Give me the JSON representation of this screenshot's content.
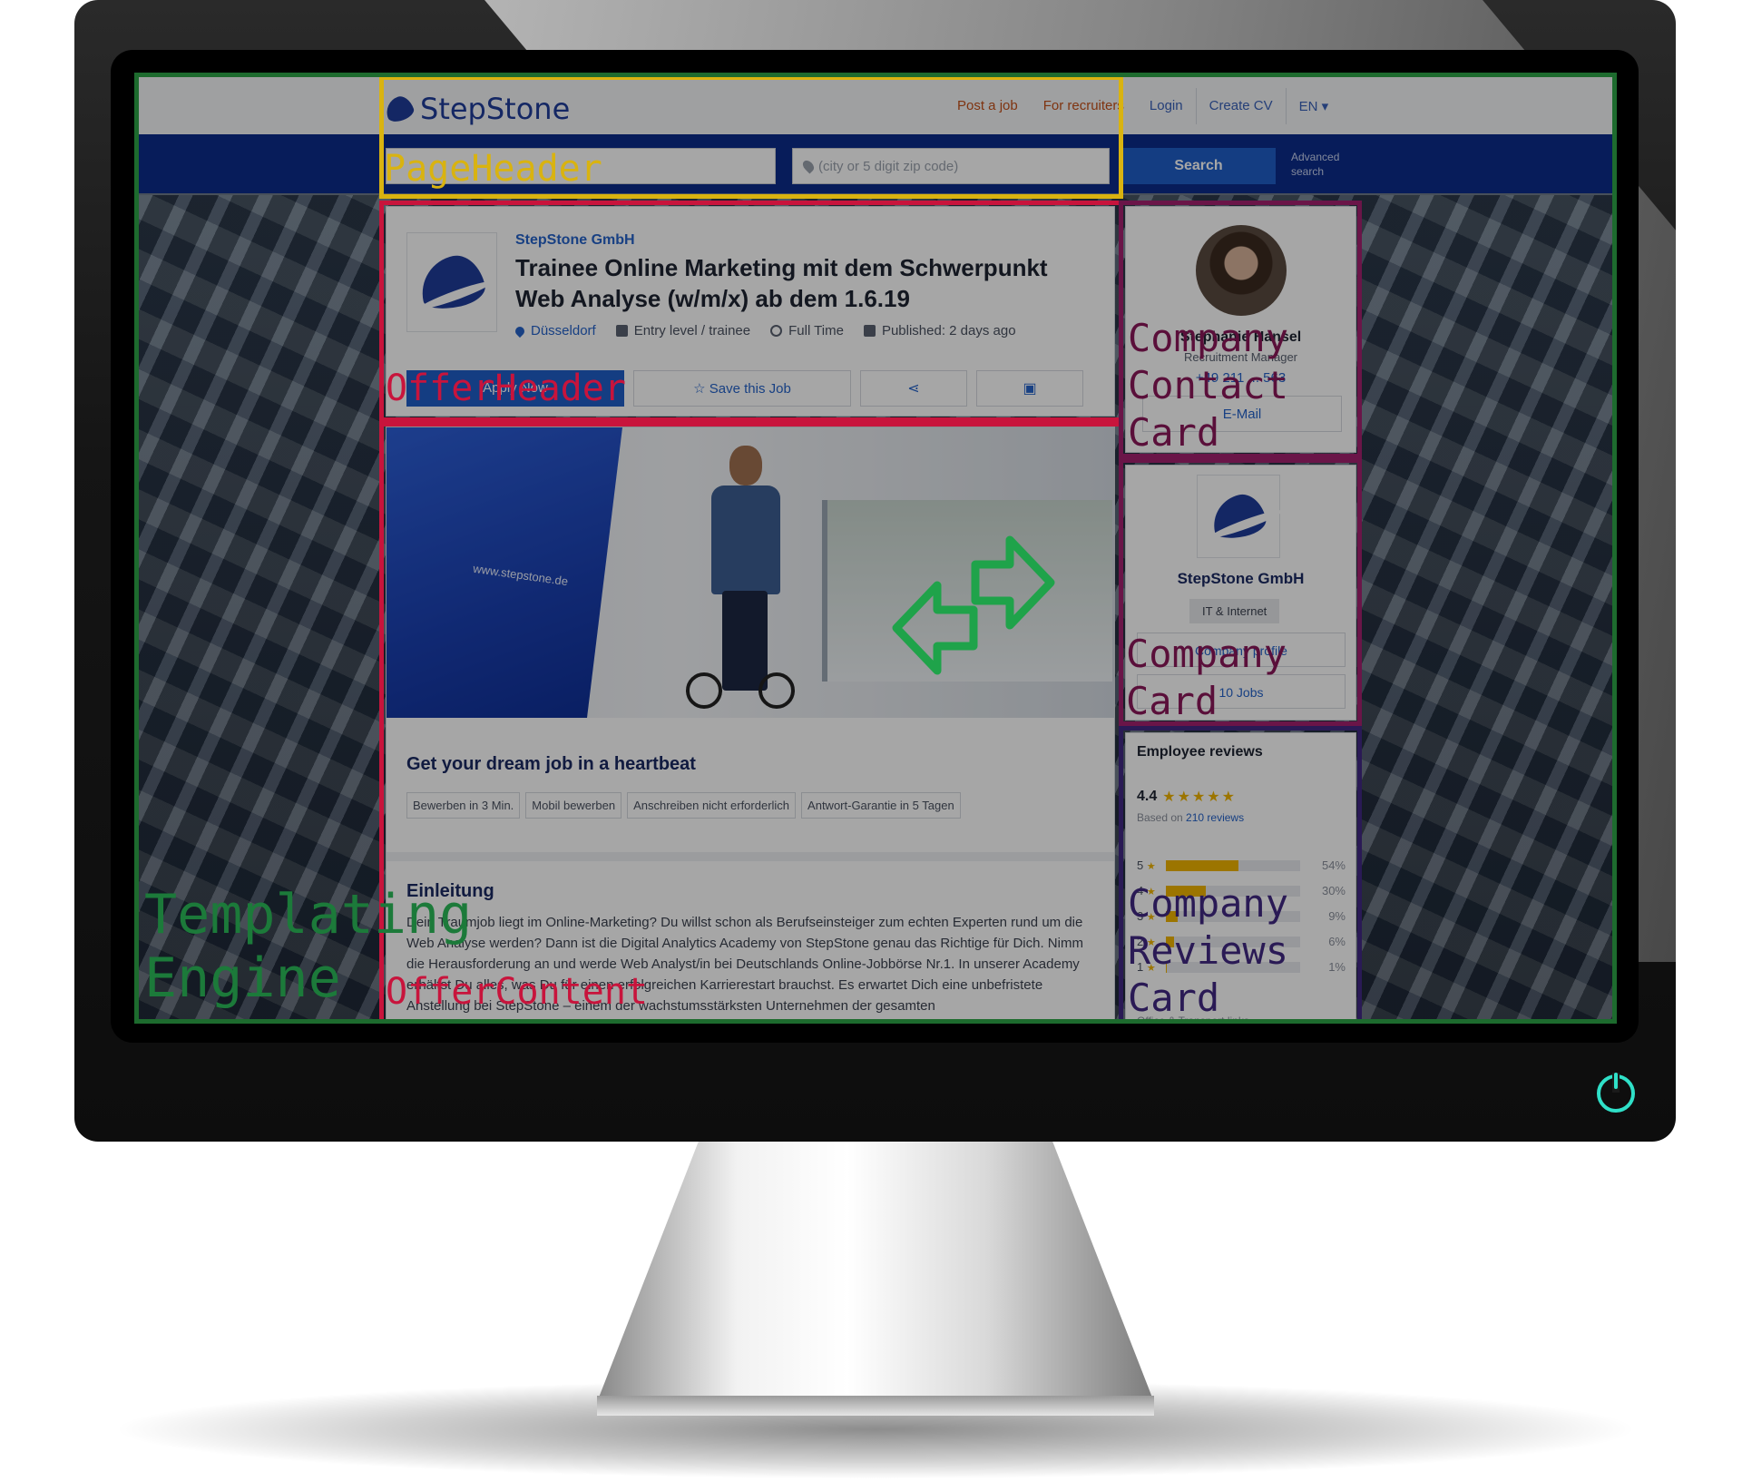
{
  "header": {
    "brand": "StepStone",
    "nav": [
      "Post a job",
      "For recruiters",
      "Login",
      "Create CV",
      "EN"
    ],
    "where_placeholder": "(city or 5 digit zip code)",
    "search_label": "Search",
    "advanced_search": "Advanced search"
  },
  "offer": {
    "company": "StepStone GmbH",
    "title": "Trainee Online Marketing mit dem Schwerpunkt Web Analyse (w/m/x) ab dem 1.6.19",
    "location": "Düsseldorf",
    "level": "Entry level / trainee",
    "contract": "Full Time",
    "published": "Published: 2 days ago",
    "apply": "Apply Now",
    "save": "☆ Save this Job",
    "hero_url": "www.stepstone.de",
    "headline": "Get your dream job in a heartbeat",
    "tags": [
      "Bewerben in 3 Min.",
      "Mobil bewerben",
      "Anschreiben nicht erforderlich",
      "Antwort-Garantie in 5 Tagen"
    ],
    "section_title": "Einleitung",
    "section_text": "Dein Traumjob liegt im Online-Marketing? Du willst schon als Berufseinsteiger zum echten Experten rund um die Web Analyse werden? Dann ist die Digital Analytics Academy von StepStone genau das Richtige für Dich. Nimm die Herausforderung an und werde Web Analyst/in bei Deutschlands Online-Jobbörse Nr.1. In unserer Academy erhältst Du alles, was Du für einen erfolgreichen Karrierestart brauchst. Es erwartet Dich eine unbefristete Anstellung bei StepStone – einem der wachstumsstärksten Unternehmen der gesamten"
  },
  "contact": {
    "name": "Stephanie Hansel",
    "role": "Recruitment Manager",
    "phone": "+49 211 ... 563",
    "email": "E-Mail"
  },
  "company_card": {
    "name": "StepStone GmbH",
    "industry": "IT & Internet",
    "profile": "Company profile",
    "jobs": "10 Jobs"
  },
  "reviews": {
    "title": "Employee reviews",
    "score": "4.4",
    "stars": "★★★★★",
    "based_prefix": "Based on ",
    "based_link": "210 reviews",
    "rows": [
      {
        "star": "5",
        "pct": "54%",
        "value": 54
      },
      {
        "star": "4",
        "pct": "30%",
        "value": 30
      },
      {
        "star": "3",
        "pct": "9%",
        "value": 9
      },
      {
        "star": "2",
        "pct": "6%",
        "value": 6
      },
      {
        "star": "1",
        "pct": "1%",
        "value": 1
      }
    ],
    "footer": "Office & Transport links"
  },
  "annotations": {
    "page_header": "PageHeader",
    "offer_header": "OfferHeader",
    "offer_content": "OfferContent",
    "contact_card": [
      "Company",
      "Contact",
      "Card"
    ],
    "company_card": [
      "Company",
      "Card"
    ],
    "reviews_card": [
      "Company",
      "Reviews",
      "Card"
    ],
    "engine": [
      "Templating",
      "Engine"
    ]
  },
  "colors": {
    "brand": "#1f3d9a",
    "search_bar": "#0b2c8a",
    "page_header_box": "#d9b310",
    "offer_box": "#c8143c",
    "contact_box": "#6a1548",
    "reviews_box": "#2a1a55",
    "engine_box": "#1c7a3a",
    "arrow": "#1fa34a",
    "power": "#2fe0c8"
  }
}
